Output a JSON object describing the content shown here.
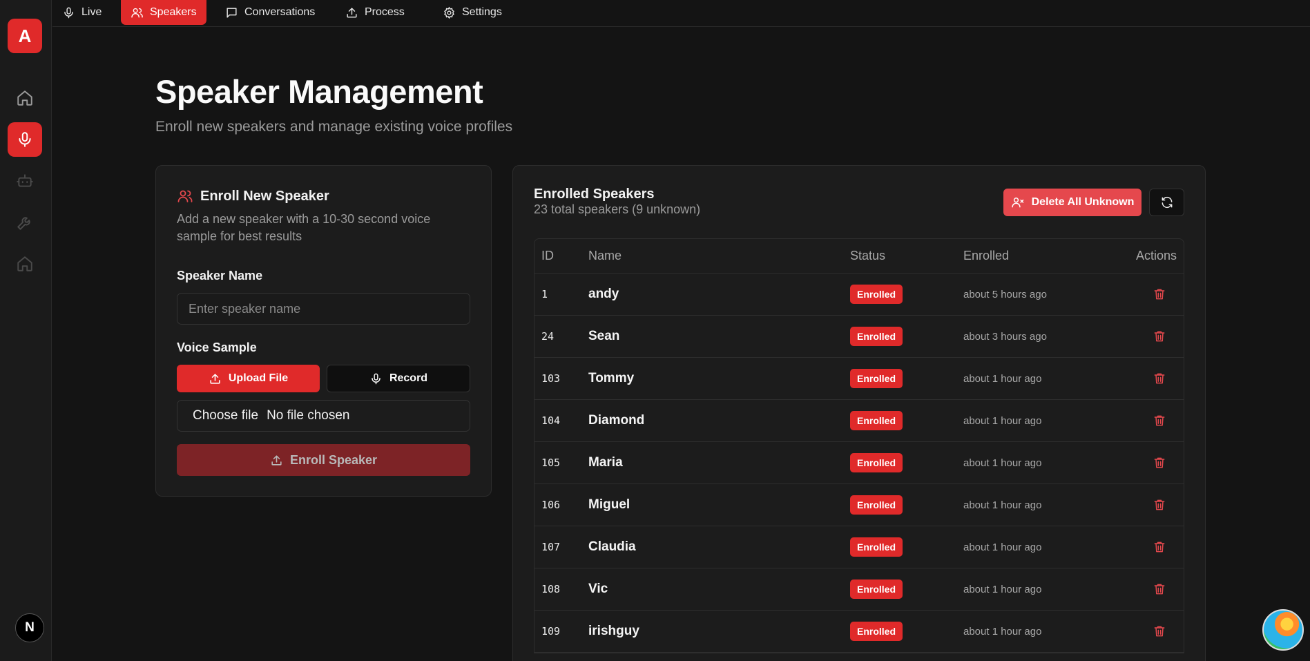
{
  "app": {
    "logo_letter": "A",
    "corner_badge": "N"
  },
  "nav": {
    "tabs": [
      {
        "label": "Live",
        "icon": "mic-icon"
      },
      {
        "label": "Speakers",
        "icon": "users-icon",
        "active": true
      },
      {
        "label": "Conversations",
        "icon": "chat-icon"
      },
      {
        "label": "Process",
        "icon": "upload-icon"
      },
      {
        "label": "Settings",
        "icon": "gear-icon"
      }
    ]
  },
  "sidebar": {
    "items": [
      {
        "icon": "home-icon"
      },
      {
        "icon": "mic-icon",
        "active": true
      },
      {
        "icon": "bot-icon"
      },
      {
        "icon": "wrench-icon"
      },
      {
        "icon": "home-icon"
      }
    ]
  },
  "page": {
    "title": "Speaker Management",
    "subtitle": "Enroll new speakers and manage existing voice profiles"
  },
  "enroll": {
    "title": "Enroll New Speaker",
    "description": "Add a new speaker with a 10-30 second voice sample for best results",
    "name_label": "Speaker Name",
    "name_placeholder": "Enter speaker name",
    "sample_label": "Voice Sample",
    "upload_label": "Upload File",
    "record_label": "Record",
    "choose_file_label": "Choose file",
    "no_file_label": "No file chosen",
    "submit_label": "Enroll Speaker"
  },
  "speakers": {
    "title": "Enrolled Speakers",
    "summary": "23 total speakers (9 unknown)",
    "delete_unknown_label": "Delete All Unknown",
    "columns": {
      "id": "ID",
      "name": "Name",
      "status": "Status",
      "enrolled": "Enrolled",
      "actions": "Actions"
    },
    "rows": [
      {
        "id": "1",
        "name": "andy",
        "status": "Enrolled",
        "enrolled": "about 5 hours ago"
      },
      {
        "id": "24",
        "name": "Sean",
        "status": "Enrolled",
        "enrolled": "about 3 hours ago"
      },
      {
        "id": "103",
        "name": "Tommy",
        "status": "Enrolled",
        "enrolled": "about 1 hour ago"
      },
      {
        "id": "104",
        "name": "Diamond",
        "status": "Enrolled",
        "enrolled": "about 1 hour ago"
      },
      {
        "id": "105",
        "name": "Maria",
        "status": "Enrolled",
        "enrolled": "about 1 hour ago"
      },
      {
        "id": "106",
        "name": "Miguel",
        "status": "Enrolled",
        "enrolled": "about 1 hour ago"
      },
      {
        "id": "107",
        "name": "Claudia",
        "status": "Enrolled",
        "enrolled": "about 1 hour ago"
      },
      {
        "id": "108",
        "name": "Vic",
        "status": "Enrolled",
        "enrolled": "about 1 hour ago"
      },
      {
        "id": "109",
        "name": "irishguy",
        "status": "Enrolled",
        "enrolled": "about 1 hour ago"
      }
    ]
  },
  "colors": {
    "accent": "#e02a2a",
    "background": "#141414",
    "card": "#1c1c1c"
  }
}
